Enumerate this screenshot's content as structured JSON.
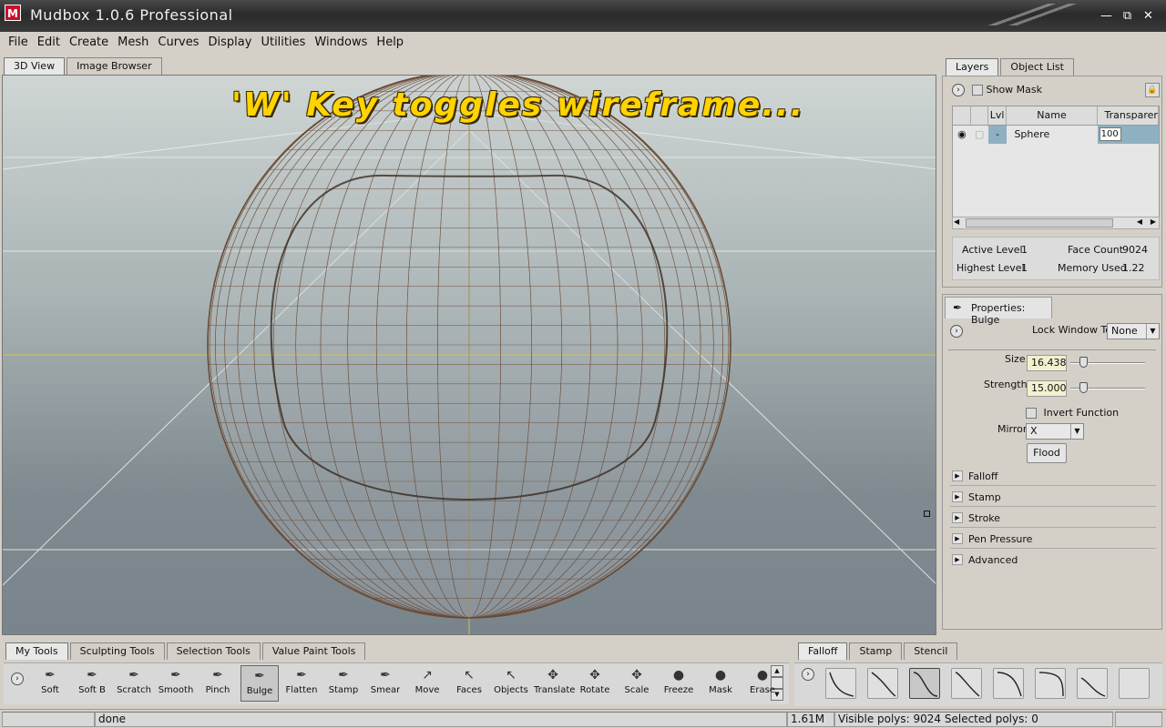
{
  "window": {
    "title": "Mudbox 1.0.6 Professional",
    "app_icon": "M"
  },
  "menubar": {
    "items": [
      "File",
      "Edit",
      "Create",
      "Mesh",
      "Curves",
      "Display",
      "Utilities",
      "Windows",
      "Help"
    ]
  },
  "viewport_tabs": [
    "3D View",
    "Image Browser"
  ],
  "viewport": {
    "banner": "'W' Key toggles wireframe..."
  },
  "layers_panel": {
    "tabs": [
      "Layers",
      "Object List"
    ],
    "show_mask_label": "Show Mask",
    "columns": [
      "Lvl",
      "Name",
      "Transparency"
    ],
    "row": {
      "lvl": "-",
      "name": "Sphere",
      "transparency": "100"
    },
    "stats": {
      "active_level_label": "Active Level",
      "active_level": "1",
      "highest_level_label": "Highest Level",
      "highest_level": "1",
      "face_count_label": "Face Count",
      "face_count": "9024",
      "memory_used_label": "Memory Used",
      "memory_used": "1.22"
    }
  },
  "properties": {
    "title": "Properties: Bulge",
    "lock_window_label": "Lock Window To:",
    "lock_window_value": "None",
    "size_label": "Size",
    "size_value": "16.438",
    "strength_label": "Strength",
    "strength_value": "15.000",
    "invert_label": "Invert Function",
    "mirror_label": "Mirror",
    "mirror_value": "X",
    "flood_label": "Flood",
    "sections": [
      "Falloff",
      "Stamp",
      "Stroke",
      "Pen Pressure",
      "Advanced"
    ]
  },
  "tool_tabs": [
    "My Tools",
    "Sculpting Tools",
    "Selection Tools",
    "Value Paint Tools"
  ],
  "tools": [
    "Soft",
    "Soft B",
    "Scratch",
    "Smooth",
    "Pinch",
    "Bulge",
    "Flatten",
    "Stamp",
    "Smear",
    "Move",
    "Faces",
    "Objects",
    "Translate",
    "Rotate",
    "Scale",
    "Freeze",
    "Mask",
    "Erase"
  ],
  "active_tool": "Bulge",
  "falloff_tabs": [
    "Falloff",
    "Stamp",
    "Stencil"
  ],
  "statusbar": {
    "message": "done",
    "memory": "1.61M",
    "polys": "Visible polys: 9024  Selected polys: 0"
  }
}
